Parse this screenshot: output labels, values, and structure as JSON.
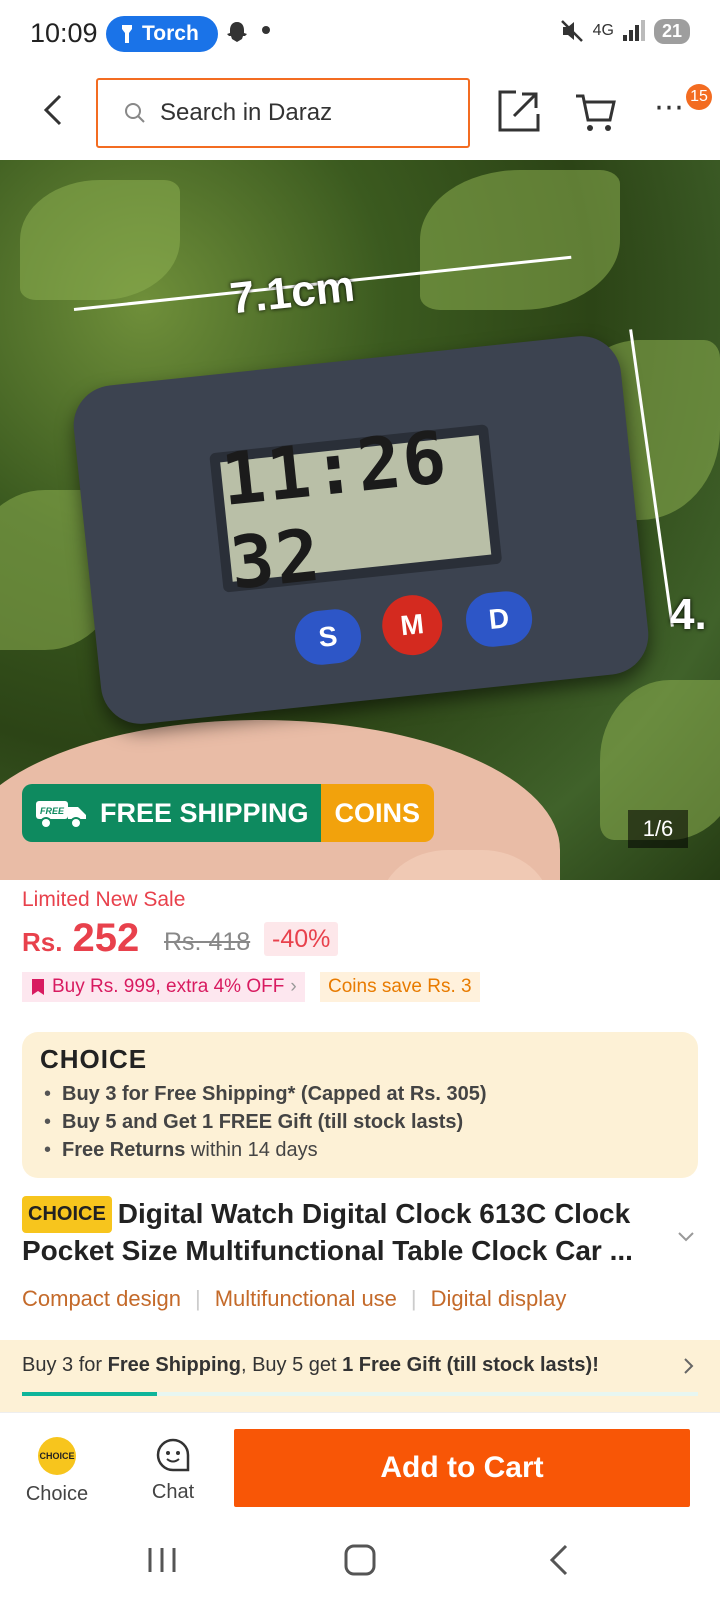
{
  "status_bar": {
    "time": "10:09",
    "torch_label": "Torch",
    "network": "4G",
    "battery": "21"
  },
  "top_bar": {
    "search_placeholder": "Search in Daraz",
    "cart_badge": "15"
  },
  "hero": {
    "width_label": "7.1cm",
    "height_label": "4.",
    "lcd_time": "11:26 32",
    "buttons": [
      "S",
      "M",
      "D"
    ],
    "free_shipping_label": "FREE SHIPPING",
    "free_badge": "FREE",
    "coins_label": "COINS",
    "image_counter": "1/6"
  },
  "price": {
    "sale_label": "Limited New Sale",
    "currency": "Rs.",
    "current": "252",
    "original": "Rs. 418",
    "discount": "-40%",
    "promo": "Buy Rs. 999, extra 4% OFF",
    "coins_save": "Coins save Rs. 3"
  },
  "choice_box": {
    "logo": "CHOICE",
    "items": [
      {
        "bold": "Buy 3 for  Free Shipping* (Capped at Rs. 305)",
        "rest": ""
      },
      {
        "bold": "Buy 5 and Get 1 FREE Gift (till stock lasts)",
        "rest": ""
      },
      {
        "bold": "Free Returns",
        "rest": " within 14 days"
      }
    ]
  },
  "product": {
    "tag": "CHOICE",
    "title": "Digital Watch Digital Clock 613C Clock Pocket Size Multifunctional Table Clock Car ...",
    "features": [
      "Compact design",
      "Multifunctional use",
      "Digital display"
    ]
  },
  "banner": {
    "part1": "Buy 3 for ",
    "bold1": "Free Shipping",
    "part2": ", Buy 5 get ",
    "bold2": "1 Free Gift (till stock lasts)!",
    "progress": 0.2
  },
  "bottom_bar": {
    "choice_label": "Choice",
    "choice_icon_text": "CHOICE",
    "chat_label": "Chat",
    "add_to_cart": "Add to Cart"
  },
  "colors": {
    "accent": "#f85606",
    "price_red": "#e8414c",
    "choice_yellow": "#f7c51d",
    "free_ship_green": "#0e8a5f"
  }
}
